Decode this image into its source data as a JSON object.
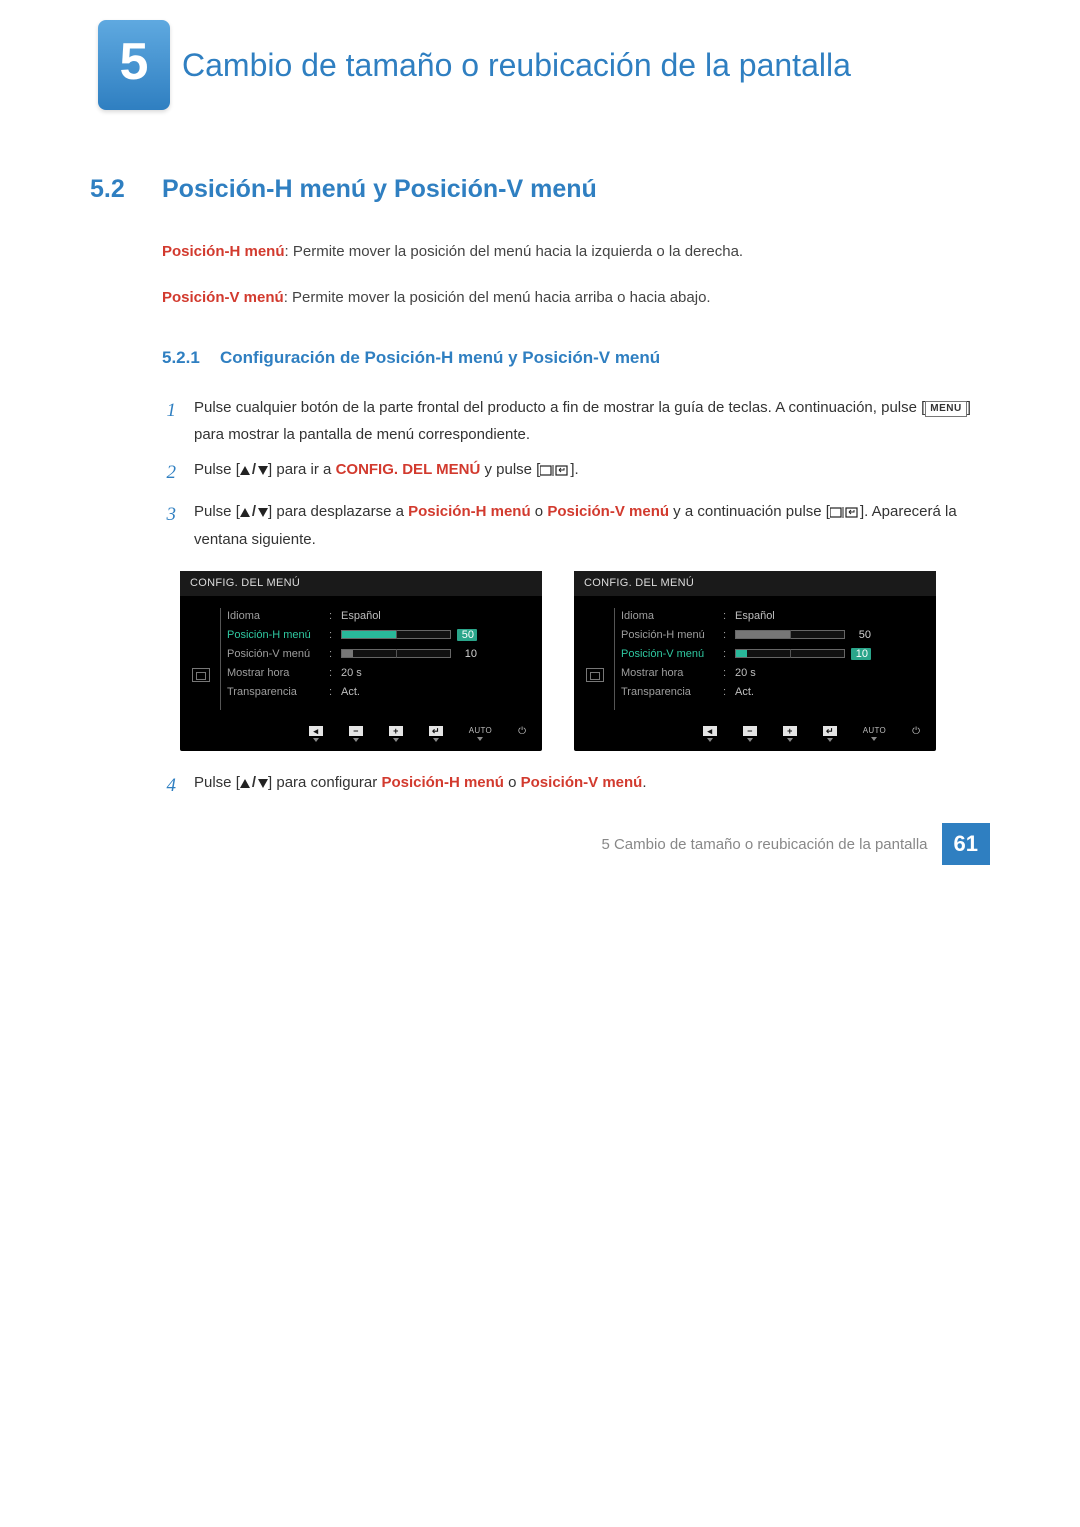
{
  "chapter": {
    "number": "5",
    "title": "Cambio de tamaño o reubicación de la pantalla"
  },
  "section": {
    "number": "5.2",
    "title": "Posición-H menú y Posición-V menú"
  },
  "definitions": {
    "h_term": "Posición-H menú",
    "h_desc": ": Permite mover la posición del menú hacia la izquierda o la derecha.",
    "v_term": "Posición-V menú",
    "v_desc": ": Permite mover la posición del menú hacia arriba o hacia abajo."
  },
  "subsection": {
    "number": "5.2.1",
    "title": "Configuración de Posición-H menú y Posición-V menú"
  },
  "steps": {
    "s1": {
      "num": "1",
      "text_a": "Pulse cualquier botón de la parte frontal del producto a fin de mostrar la guía de teclas. A continuación, pulse [",
      "menu_tag": "MENU",
      "text_b": "] para mostrar la pantalla de menú correspondiente."
    },
    "s2": {
      "num": "2",
      "text_a": "Pulse [",
      "text_b": "] para ir a ",
      "config_label": "CONFIG. DEL MENÚ",
      "text_c": " y pulse [",
      "text_d": "]."
    },
    "s3": {
      "num": "3",
      "text_a": "Pulse [",
      "text_b": "] para desplazarse a ",
      "h_label": "Posición-H menú",
      "text_c": " o ",
      "v_label": "Posición-V menú",
      "text_d": " y a continuación pulse [",
      "text_e": "]. Aparecerá la ventana siguiente."
    },
    "s4": {
      "num": "4",
      "text_a": "Pulse [",
      "text_b": "] para configurar ",
      "h_label": "Posición-H menú",
      "text_c": " o ",
      "v_label": "Posición-V menú",
      "text_d": "."
    }
  },
  "osd": {
    "header": "CONFIG. DEL MENÚ",
    "rows": {
      "idioma": {
        "label": "Idioma",
        "value": "Español"
      },
      "posh": {
        "label": "Posición-H menú",
        "value": "50"
      },
      "posv": {
        "label": "Posición-V menú",
        "value": "10"
      },
      "mostrar": {
        "label": "Mostrar hora",
        "value": "20 s"
      },
      "trans": {
        "label": "Transparencia",
        "value": "Act."
      }
    },
    "footer": {
      "auto": "AUTO"
    }
  },
  "footer": {
    "text": "5 Cambio de tamaño o reubicación de la pantalla",
    "page": "61"
  }
}
